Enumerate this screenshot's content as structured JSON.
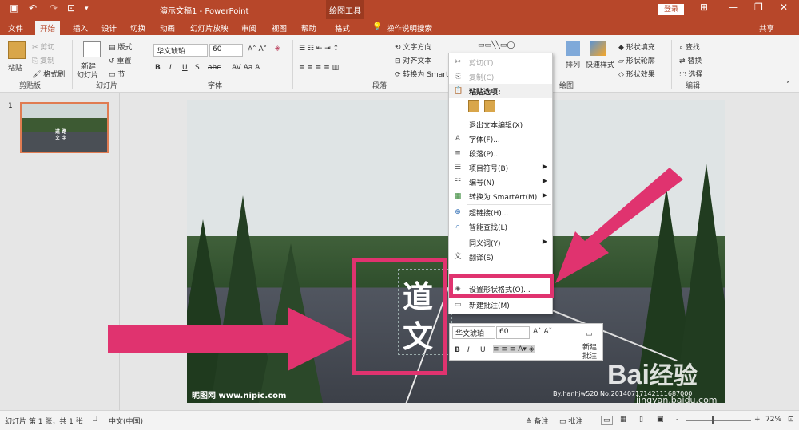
{
  "titlebar": {
    "doc_title": "演示文稿1  -  PowerPoint",
    "tools_label": "绘图工具",
    "login_label": "登录",
    "quick_access": [
      "💾",
      "↶",
      "↷",
      "▾"
    ]
  },
  "tabs": [
    "文件",
    "开始",
    "插入",
    "设计",
    "切换",
    "动画",
    "幻灯片放映",
    "审阅",
    "视图",
    "帮助",
    "格式"
  ],
  "tell_me": "操作说明搜索",
  "share": "共享",
  "ribbon": {
    "clipboard": {
      "paste": "粘贴",
      "cut": "剪切",
      "copy": "复制",
      "painter": "格式刷",
      "group": "剪贴板"
    },
    "slides": {
      "new": "新建",
      "new2": "幻灯片",
      "layout": "版式",
      "reset": "重置",
      "section": "节",
      "group": "幻灯片"
    },
    "font": {
      "name": "华文琥珀",
      "size": "60",
      "group": "字体",
      "bold": "B",
      "italic": "I",
      "underline": "U",
      "shadow": "S",
      "strike": "abc"
    },
    "paragraph": {
      "text_dir": "文字方向",
      "align_text": "对齐文本",
      "smartart": "转换为 Smart",
      "group": "段落"
    },
    "drawing": {
      "arrange": "排列",
      "quick_styles": "快速样式",
      "fill": "形状填充",
      "outline": "形状轮廓",
      "effects": "形状效果",
      "group": "绘图"
    },
    "editing": {
      "find": "查找",
      "replace": "替换",
      "select": "选择",
      "group": "编辑"
    }
  },
  "slide_number": "1",
  "thumb_text": "道 路\n文 字",
  "slide_text": {
    "chars": [
      "道",
      "文"
    ],
    "watermark_left": "昵图网 www.nipic.com",
    "watermark_right": "By:hanhjw520 No:20140717142111687000"
  },
  "context_menu": [
    {
      "label": "剪切(T)",
      "disabled": true,
      "icon": "scissors-icon"
    },
    {
      "label": "复制(C)",
      "disabled": true,
      "icon": "copy-icon"
    },
    {
      "label": "粘贴选项:",
      "disabled": false,
      "icon": "paste-icon",
      "header": true
    },
    {
      "label": "",
      "paste_icons": true
    },
    {
      "label": "退出文本编辑(X)",
      "disabled": false
    },
    {
      "label": "字体(F)...",
      "icon": "font-icon"
    },
    {
      "label": "段落(P)...",
      "icon": "paragraph-icon"
    },
    {
      "label": "项目符号(B)",
      "icon": "bullets-icon",
      "submenu": true
    },
    {
      "label": "编号(N)",
      "icon": "numbering-icon",
      "submenu": true
    },
    {
      "label": "转换为 SmartArt(M)",
      "icon": "smartart-icon",
      "submenu": true
    },
    {
      "label": "超链接(H)...",
      "icon": "hyperlink-icon"
    },
    {
      "label": "智能查找(L)",
      "icon": "search-icon"
    },
    {
      "label": "同义词(Y)",
      "submenu": true
    },
    {
      "label": "翻译(S)",
      "icon": "translate-icon"
    },
    {
      "label": "设置形状格式(O)...",
      "icon": "format-shape-icon",
      "highlight": true
    },
    {
      "label": "新建批注(M)",
      "icon": "comment-icon"
    }
  ],
  "mini_toolbar": {
    "font": "华文琥珀",
    "size": "60",
    "new": "新建",
    "comment": "批注",
    "bold": "B",
    "italic": "I",
    "underline": "U"
  },
  "status": {
    "slide_info": "幻灯片 第 1 张，共 1 张",
    "language": "中文(中国)",
    "notes": "备注",
    "comments": "批注",
    "zoom": "72%",
    "minus": "-",
    "plus": "+"
  },
  "watermark": {
    "brand": "Bai",
    "brand2": "经验",
    "url": "jingyan.baidu.com"
  },
  "colors": {
    "accent": "#b7472a",
    "highlight": "#e0336f"
  }
}
